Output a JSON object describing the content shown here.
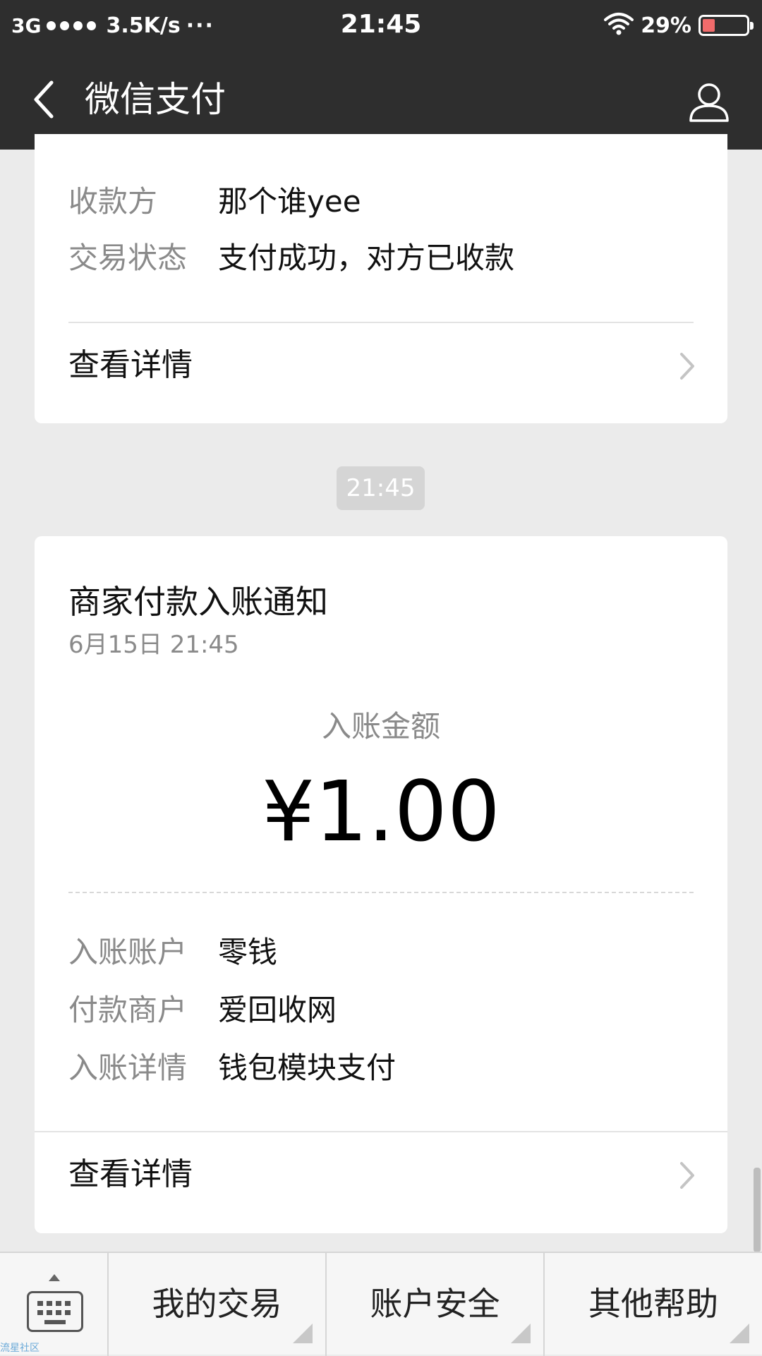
{
  "status_bar": {
    "network": "3G",
    "speed": "3.5K/s",
    "more": "···",
    "time": "21:45",
    "battery": "29%",
    "battery_level": 0.29
  },
  "header": {
    "title": "微信支付"
  },
  "payment_card": {
    "rows": [
      {
        "label": "收款方",
        "value": "那个谁yee"
      },
      {
        "label": "交易状态",
        "value": "支付成功，对方已收款"
      }
    ],
    "detail_link": "查看详情"
  },
  "timestamp_chip": "21:45",
  "notification_card": {
    "title": "商家付款入账通知",
    "date": "6月15日  21:45",
    "amount_label": "入账金额",
    "amount": "¥1.00",
    "rows": [
      {
        "label": "入账账户",
        "value": "零钱"
      },
      {
        "label": "付款商户",
        "value": "爱回收网"
      },
      {
        "label": "入账详情",
        "value": "钱包模块支付"
      }
    ],
    "detail_link": "查看详情"
  },
  "bottom_menu": {
    "items": [
      {
        "label": "我的交易"
      },
      {
        "label": "账户安全"
      },
      {
        "label": "其他帮助"
      }
    ],
    "watermark": "流星社区"
  },
  "colors": {
    "header_bg": "#2e2e2e",
    "page_bg": "#ebebeb",
    "label_gray": "#8a8a8a",
    "battery_low": "#f06b6b"
  }
}
